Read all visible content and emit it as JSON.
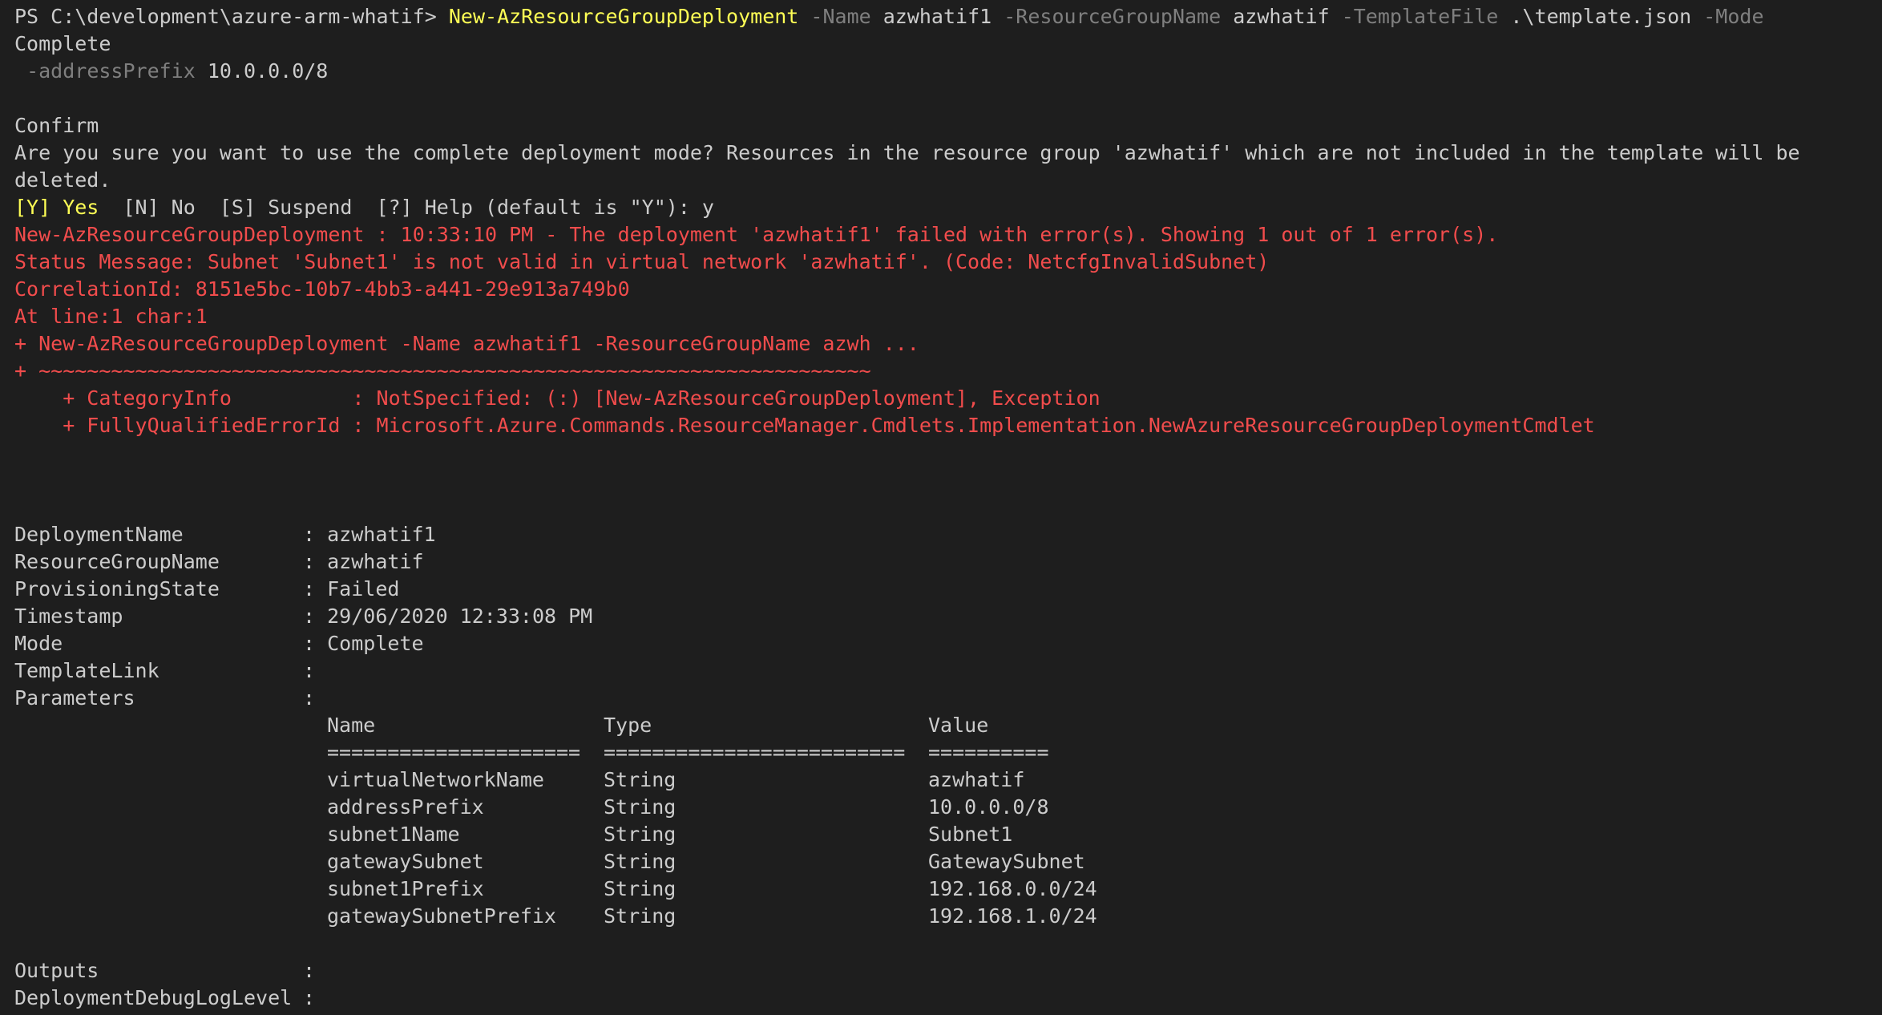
{
  "terminal": {
    "prompt": "PS C:\\development\\azure-arm-whatif> ",
    "command": {
      "cmdlet": "New-AzResourceGroupDeployment",
      "name_flag": " -Name ",
      "name_value": "azwhatif1",
      "rg_flag": " -ResourceGroupName ",
      "rg_value": "azwhatif",
      "template_flag": " -TemplateFile ",
      "template_value": ".\\template.json",
      "mode_flag": " -Mode ",
      "mode_value": "Complete",
      "prefix_flag": " -addressPrefix ",
      "prefix_value": "10.0.0.0/8"
    },
    "confirm": {
      "title": "Confirm",
      "question": "Are you sure you want to use the complete deployment mode? Resources in the resource group 'azwhatif' which are not included in the template will be deleted.",
      "opt_yes": "[Y] Yes",
      "opt_rest": "  [N] No  [S] Suspend  [?] Help (default is \"Y\"): y"
    },
    "error": [
      "New-AzResourceGroupDeployment : 10:33:10 PM - The deployment 'azwhatif1' failed with error(s). Showing 1 out of 1 error(s).",
      "Status Message: Subnet 'Subnet1' is not valid in virtual network 'azwhatif'. (Code: NetcfgInvalidSubnet)",
      "CorrelationId: 8151e5bc-10b7-4bb3-a441-29e913a749b0",
      "At line:1 char:1",
      "+ New-AzResourceGroupDeployment -Name azwhatif1 -ResourceGroupName azwh ...",
      "+ ~~~~~~~~~~~~~~~~~~~~~~~~~~~~~~~~~~~~~~~~~~~~~~~~~~~~~~~~~~~~~~~~~~~~~",
      "    + CategoryInfo          : NotSpecified: (:) [New-AzResourceGroupDeployment], Exception",
      "    + FullyQualifiedErrorId : Microsoft.Azure.Commands.ResourceManager.Cmdlets.Implementation.NewAzureResourceGroupDeploymentCmdlet"
    ],
    "properties": [
      {
        "key": "DeploymentName",
        "value": "azwhatif1"
      },
      {
        "key": "ResourceGroupName",
        "value": "azwhatif"
      },
      {
        "key": "ProvisioningState",
        "value": "Failed"
      },
      {
        "key": "Timestamp",
        "value": "29/06/2020 12:33:08 PM"
      },
      {
        "key": "Mode",
        "value": "Complete"
      },
      {
        "key": "TemplateLink",
        "value": ""
      },
      {
        "key": "Parameters",
        "value": ""
      }
    ],
    "sep": ": ",
    "params_table": {
      "headers": [
        "Name",
        "Type",
        "Value"
      ],
      "underlines": [
        "=====================",
        "=========================",
        "=========="
      ],
      "rows": [
        [
          "virtualNetworkName",
          "String",
          "azwhatif"
        ],
        [
          "addressPrefix",
          "String",
          "10.0.0.0/8"
        ],
        [
          "subnet1Name",
          "String",
          "Subnet1"
        ],
        [
          "gatewaySubnet",
          "String",
          "GatewaySubnet"
        ],
        [
          "subnet1Prefix",
          "String",
          "192.168.0.0/24"
        ],
        [
          "gatewaySubnetPrefix",
          "String",
          "192.168.1.0/24"
        ]
      ]
    },
    "trailing_properties": [
      {
        "key": "Outputs",
        "value": ""
      },
      {
        "key": "DeploymentDebugLogLevel",
        "value": ""
      }
    ]
  },
  "colors": {
    "background": "#1e1e1e",
    "text": "#cccccc",
    "command": "#ffff55",
    "parameter": "#7f7f7f",
    "error": "#f14c4c"
  }
}
